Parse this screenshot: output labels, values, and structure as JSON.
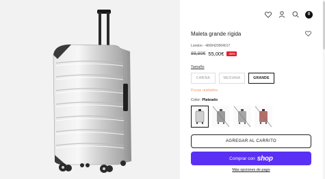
{
  "header": {
    "cart_count": "0"
  },
  "product": {
    "title": "Maleta grande rígida",
    "sku": "London - 4800420004017",
    "old_price": "89,90€",
    "new_price": "55,00€",
    "discount": "-39%"
  },
  "size": {
    "label": "Tamaño",
    "options": [
      "CABINA",
      "MEDIANA",
      "GRANDE"
    ],
    "selected": "GRANDE"
  },
  "stock_text": "Pocas unidades",
  "color": {
    "label": "Color:",
    "selected": "Plateado",
    "swatches": [
      {
        "name": "Plateado",
        "hex": "#c8c8c8",
        "available": true
      },
      {
        "name": "gris",
        "hex": "#9a9a9a",
        "available": false
      },
      {
        "name": "gris-oscuro",
        "hex": "#a6a6a6",
        "available": false
      },
      {
        "name": "rosa",
        "hex": "#b5706a",
        "available": false
      }
    ]
  },
  "actions": {
    "add_to_cart": "AGREGAR AL CARRITO",
    "buy_with_prefix": "Comprar con",
    "shop_brand": "shop",
    "more_payment": "Más opciones de pago"
  },
  "colors": {
    "shop_purple": "#5a31f4",
    "discount_red": "#e0202a",
    "stock_orange": "#f09a6b"
  },
  "icons": [
    "heart-icon",
    "user-icon",
    "search-icon",
    "cart-icon"
  ]
}
